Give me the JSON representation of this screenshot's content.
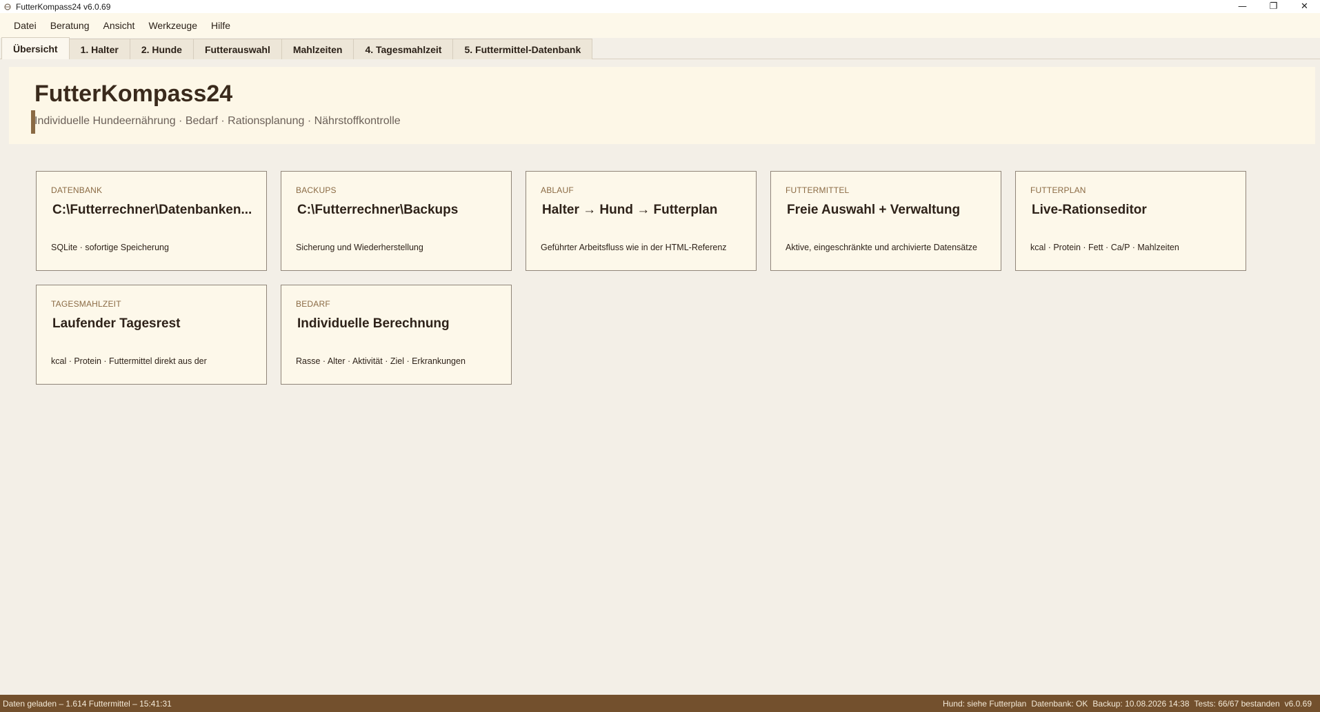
{
  "window": {
    "title": "FutterKompass24 v6.0.69",
    "controls": {
      "minimize": "—",
      "restore": "❐",
      "close": "✕"
    }
  },
  "menu": [
    "Datei",
    "Beratung",
    "Ansicht",
    "Werkzeuge",
    "Hilfe"
  ],
  "tabs": [
    {
      "label": "Übersicht",
      "active": true
    },
    {
      "label": "1. Halter",
      "active": false
    },
    {
      "label": "2. Hunde",
      "active": false
    },
    {
      "label": "Futterauswahl",
      "active": false
    },
    {
      "label": "Mahlzeiten",
      "active": false
    },
    {
      "label": "4. Tagesmahlzeit",
      "active": false
    },
    {
      "label": "5. Futtermittel-Datenbank",
      "active": false
    }
  ],
  "header": {
    "title": "FutterKompass24",
    "subtitle": "Individuelle Hundeernährung · Bedarf · Rationsplanung · Nährstoffkontrolle"
  },
  "cards": [
    {
      "label": "DATENBANK",
      "value": "C:\\Futterrechner\\Datenbanken...",
      "desc": "SQLite · sofortige Speicherung"
    },
    {
      "label": "BACKUPS",
      "value": "C:\\Futterrechner\\Backups",
      "desc": "Sicherung und Wiederherstellung"
    },
    {
      "label": "ABLAUF",
      "value": "Halter → Hund → Futterplan",
      "desc": "Geführter Arbeitsfluss wie in der HTML-Referenz"
    },
    {
      "label": "FUTTERMITTEL",
      "value": "Freie Auswahl + Verwaltung",
      "desc": "Aktive, eingeschränkte und archivierte Datensätze"
    },
    {
      "label": "FUTTERPLAN",
      "value": "Live-Rationseditor",
      "desc": "kcal · Protein · Fett · Ca/P · Mahlzeiten"
    },
    {
      "label": "TAGESMAHLZEIT",
      "value": "Laufender Tagesrest",
      "desc": "kcal · Protein · Futtermittel direkt aus der"
    },
    {
      "label": "BEDARF",
      "value": "Individuelle Berechnung",
      "desc": "Rasse · Alter · Aktivität · Ziel · Erkrankungen"
    }
  ],
  "status": {
    "left": "Daten geladen – 1.614 Futtermittel – 15:41:31",
    "hund": "Hund: siehe Futterplan",
    "datenbank": "Datenbank: OK",
    "backup": "Backup: 10.08.2026 14:38",
    "tests": "Tests: 66/67 bestanden",
    "version": "v6.0.69"
  },
  "colors": {
    "accent": "#8a6a44",
    "statusbar": "#73502d",
    "card_bg": "#fdf8ea",
    "page_bg": "#f3efe7"
  }
}
